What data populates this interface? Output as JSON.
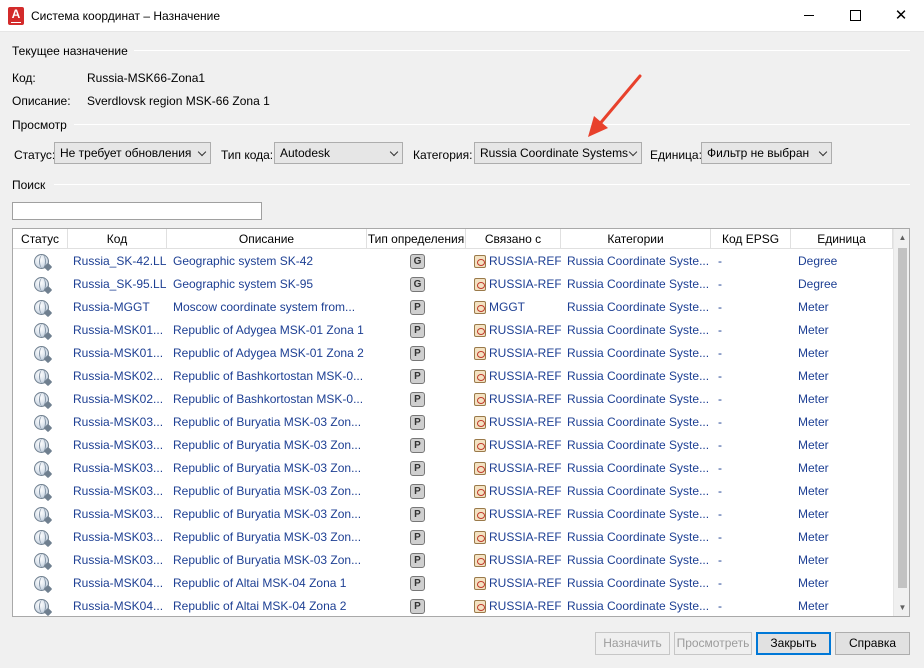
{
  "window": {
    "title": "Система координат – Назначение",
    "controls": {
      "minimize": "—",
      "maximize": "☐",
      "close": "✕"
    }
  },
  "current": {
    "section_title": "Текущее назначение",
    "code_label": "Код:",
    "code_value": "Russia-MSK66-Zona1",
    "desc_label": "Описание:",
    "desc_value": "Sverdlovsk region MSK-66 Zona 1"
  },
  "browse": {
    "section_title": "Просмотр",
    "status_label": "Статус:",
    "status_value": "Не требует обновления",
    "codetype_label": "Тип кода:",
    "codetype_value": "Autodesk",
    "category_label": "Категория:",
    "category_value": "Russia Coordinate Systems",
    "unit_label": "Единица:",
    "unit_value": "Фильтр не выбран"
  },
  "search": {
    "section_title": "Поиск",
    "value": ""
  },
  "table": {
    "columns": [
      "Статус",
      "Код",
      "Описание",
      "Тип определения",
      "Связано с",
      "Категории",
      "Код EPSG",
      "Единица"
    ],
    "rows": [
      {
        "code": "Russia_SK-42.LL",
        "desc": "Geographic system SK-42",
        "type": "G",
        "linked": "RUSSIA-REF-",
        "category": "Russia Coordinate Syste...",
        "epsg": "-",
        "unit": "Degree"
      },
      {
        "code": "Russia_SK-95.LL",
        "desc": "Geographic system SK-95",
        "type": "G",
        "linked": "RUSSIA-REF-",
        "category": "Russia Coordinate Syste...",
        "epsg": "-",
        "unit": "Degree"
      },
      {
        "code": "Russia-MGGT",
        "desc": "Moscow coordinate system from...",
        "type": "P",
        "linked": "MGGT",
        "category": "Russia Coordinate Syste...",
        "epsg": "-",
        "unit": "Meter"
      },
      {
        "code": "Russia-MSK01...",
        "desc": "Republic of Adygea MSK-01 Zona 1",
        "type": "P",
        "linked": "RUSSIA-REF-",
        "category": "Russia Coordinate Syste...",
        "epsg": "-",
        "unit": "Meter"
      },
      {
        "code": "Russia-MSK01...",
        "desc": "Republic of Adygea MSK-01 Zona 2",
        "type": "P",
        "linked": "RUSSIA-REF-",
        "category": "Russia Coordinate Syste...",
        "epsg": "-",
        "unit": "Meter"
      },
      {
        "code": "Russia-MSK02...",
        "desc": "Republic of Bashkortostan MSK-0...",
        "type": "P",
        "linked": "RUSSIA-REF-",
        "category": "Russia Coordinate Syste...",
        "epsg": "-",
        "unit": "Meter"
      },
      {
        "code": "Russia-MSK02...",
        "desc": "Republic of Bashkortostan MSK-0...",
        "type": "P",
        "linked": "RUSSIA-REF-",
        "category": "Russia Coordinate Syste...",
        "epsg": "-",
        "unit": "Meter"
      },
      {
        "code": "Russia-MSK03...",
        "desc": "Republic of Buryatia MSK-03 Zon...",
        "type": "P",
        "linked": "RUSSIA-REF-",
        "category": "Russia Coordinate Syste...",
        "epsg": "-",
        "unit": "Meter"
      },
      {
        "code": "Russia-MSK03...",
        "desc": "Republic of Buryatia MSK-03 Zon...",
        "type": "P",
        "linked": "RUSSIA-REF-",
        "category": "Russia Coordinate Syste...",
        "epsg": "-",
        "unit": "Meter"
      },
      {
        "code": "Russia-MSK03...",
        "desc": "Republic of Buryatia MSK-03 Zon...",
        "type": "P",
        "linked": "RUSSIA-REF-",
        "category": "Russia Coordinate Syste...",
        "epsg": "-",
        "unit": "Meter"
      },
      {
        "code": "Russia-MSK03...",
        "desc": "Republic of Buryatia MSK-03 Zon...",
        "type": "P",
        "linked": "RUSSIA-REF-",
        "category": "Russia Coordinate Syste...",
        "epsg": "-",
        "unit": "Meter"
      },
      {
        "code": "Russia-MSK03...",
        "desc": "Republic of Buryatia MSK-03 Zon...",
        "type": "P",
        "linked": "RUSSIA-REF-",
        "category": "Russia Coordinate Syste...",
        "epsg": "-",
        "unit": "Meter"
      },
      {
        "code": "Russia-MSK03...",
        "desc": "Republic of Buryatia MSK-03 Zon...",
        "type": "P",
        "linked": "RUSSIA-REF-",
        "category": "Russia Coordinate Syste...",
        "epsg": "-",
        "unit": "Meter"
      },
      {
        "code": "Russia-MSK03...",
        "desc": "Republic of Buryatia MSK-03 Zon...",
        "type": "P",
        "linked": "RUSSIA-REF-",
        "category": "Russia Coordinate Syste...",
        "epsg": "-",
        "unit": "Meter"
      },
      {
        "code": "Russia-MSK04...",
        "desc": "Republic of Altai MSK-04 Zona 1",
        "type": "P",
        "linked": "RUSSIA-REF-",
        "category": "Russia Coordinate Syste...",
        "epsg": "-",
        "unit": "Meter"
      },
      {
        "code": "Russia-MSK04...",
        "desc": "Republic of Altai MSK-04 Zona 2",
        "type": "P",
        "linked": "RUSSIA-REF-",
        "category": "Russia Coordinate Syste...",
        "epsg": "-",
        "unit": "Meter"
      }
    ]
  },
  "buttons": {
    "assign": "Назначить",
    "preview": "Просмотреть",
    "close": "Закрыть",
    "help": "Справка"
  },
  "colors": {
    "link_text": "#1d3f93",
    "annotation_arrow": "#e8412c",
    "default_button_border": "#0078d7"
  }
}
